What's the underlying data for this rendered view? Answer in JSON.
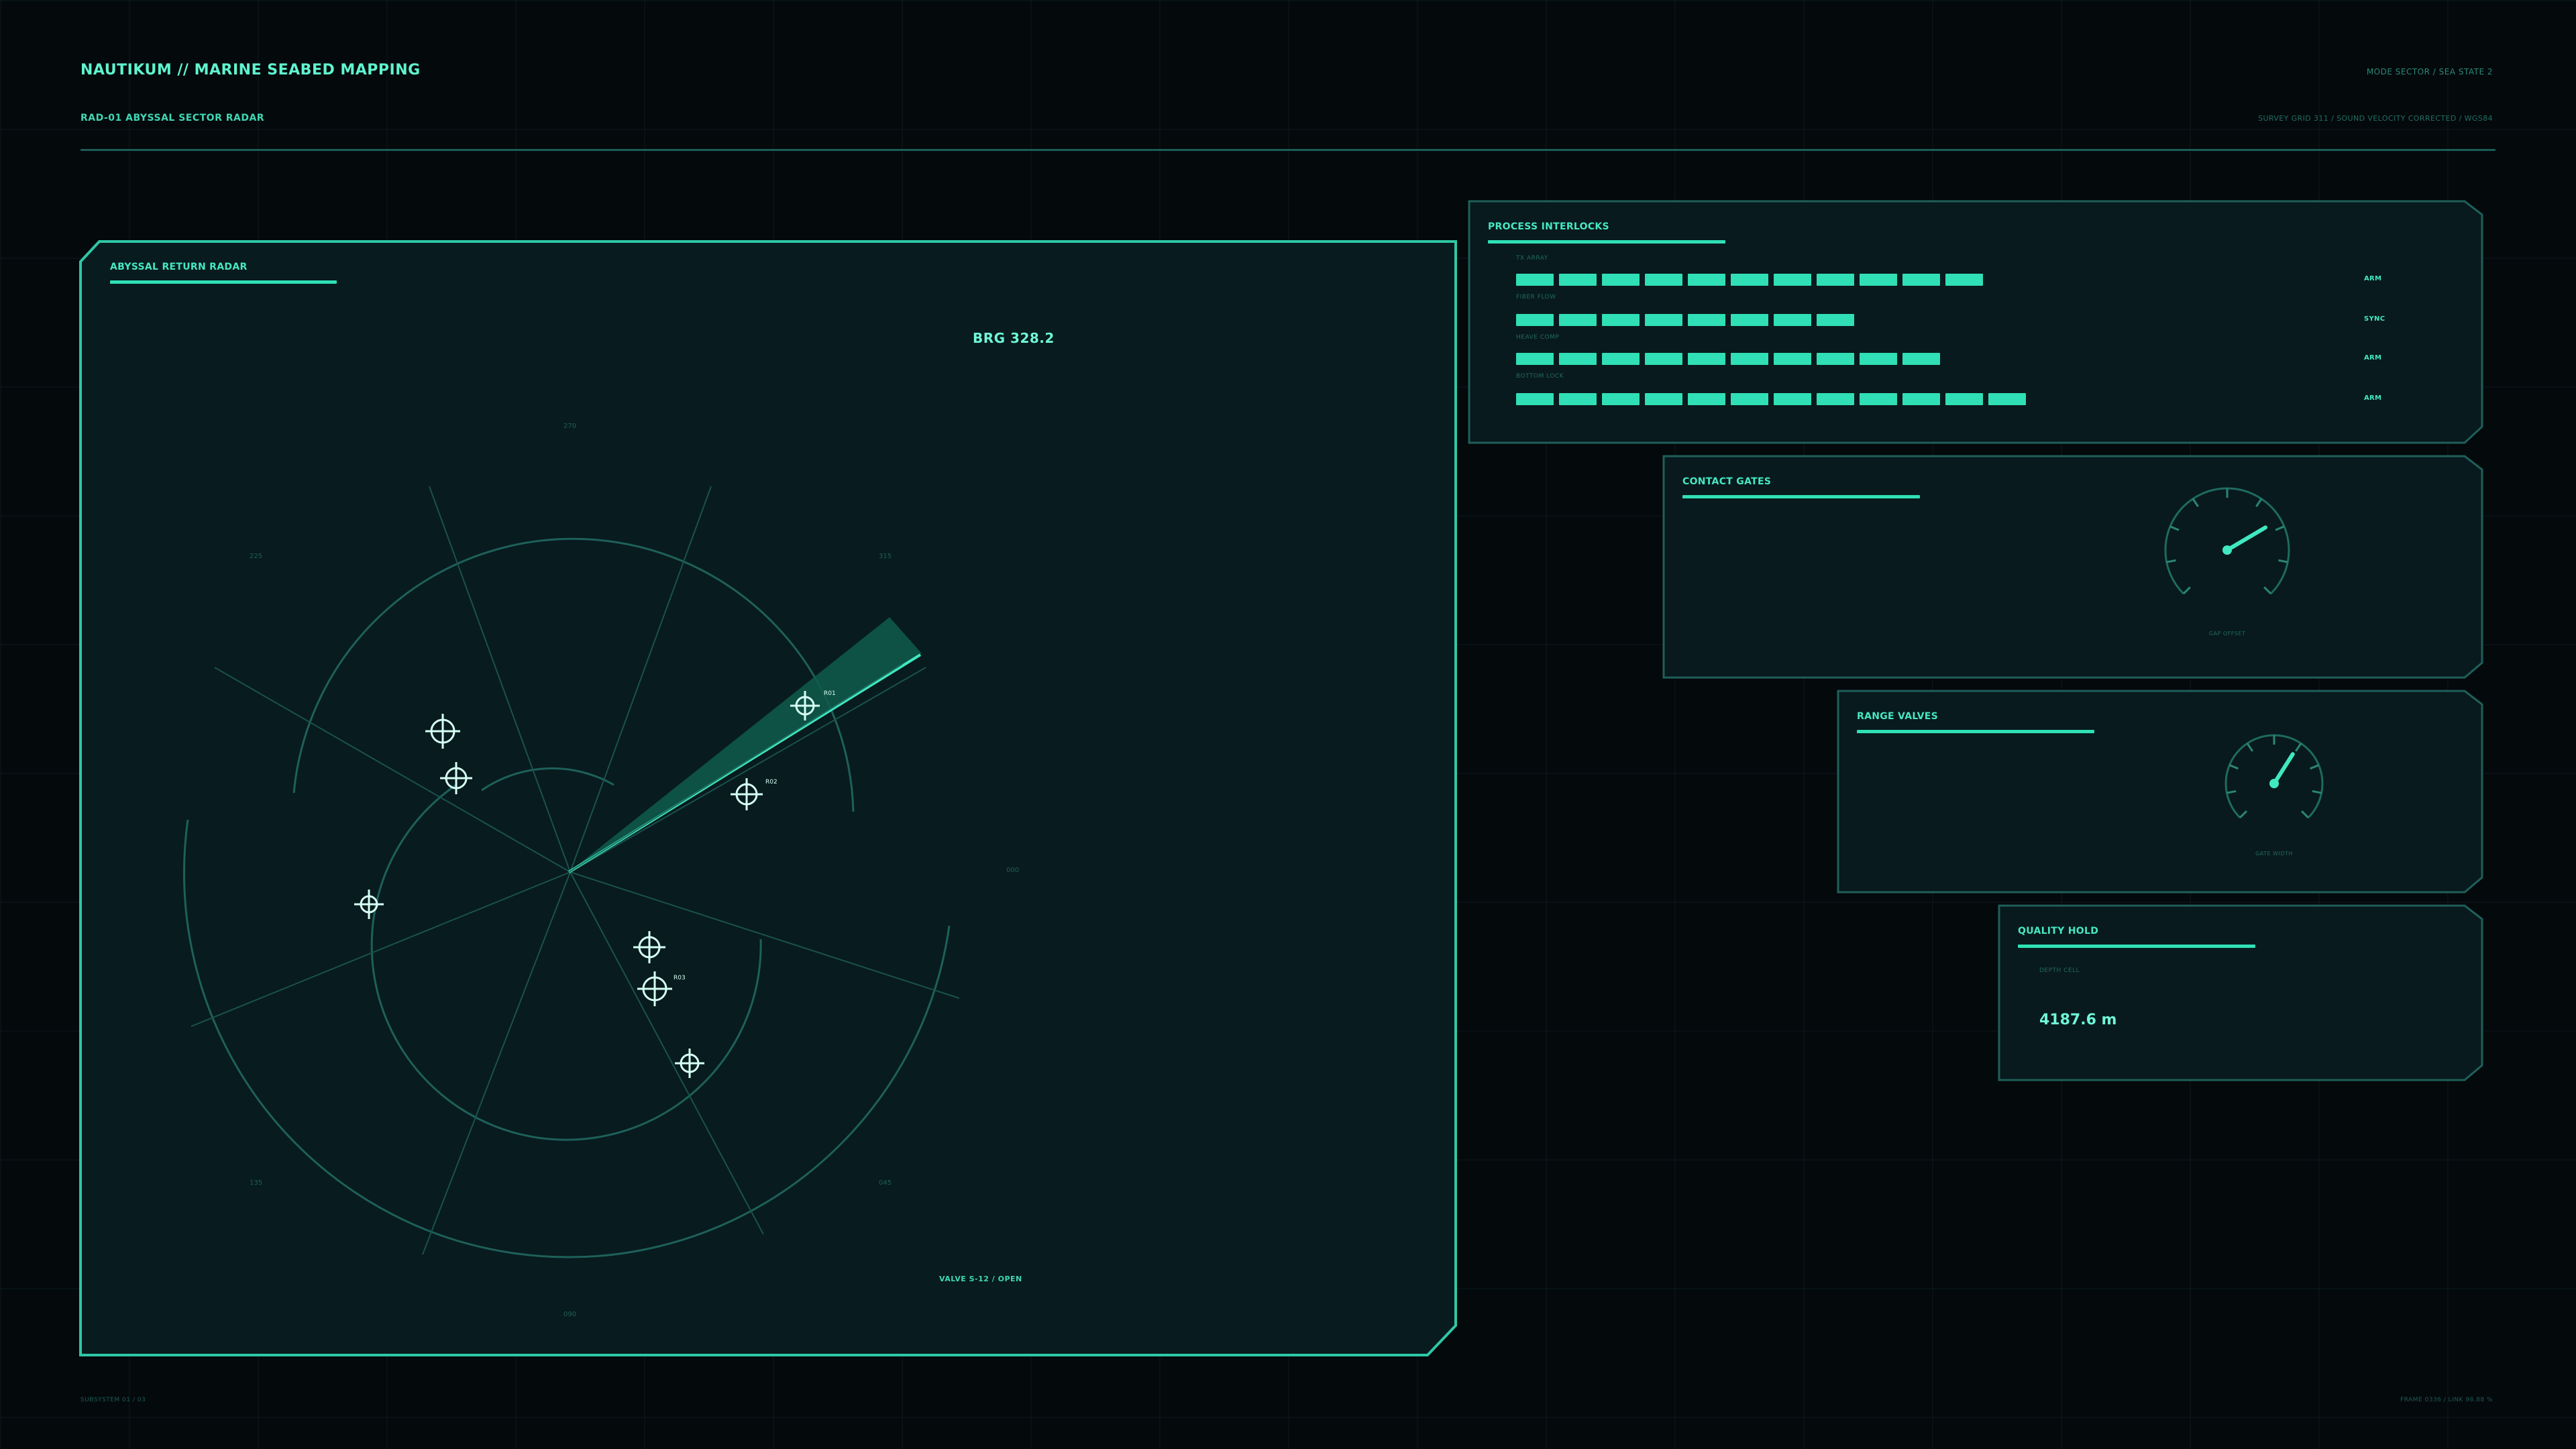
{
  "header": {
    "title": "NAUTIKUM // MARINE SEABED MAPPING",
    "subtitle": "RAD-01  ABYSSAL SECTOR RADAR",
    "mode": "MODE SECTOR / SEA STATE 2",
    "grid": "SURVEY GRID 311 / SOUND VELOCITY CORRECTED / WGS84"
  },
  "radar": {
    "title": "ABYSSAL RETURN RADAR",
    "bearing": "BRG 328.2",
    "valve": "VALVE S-12 / OPEN",
    "sweep_bearing_deg": 328.2,
    "contact_labels": [
      "R01",
      "R02",
      "R03"
    ]
  },
  "interlocks": {
    "title": "PROCESS INTERLOCKS",
    "rows": [
      {
        "label": "TX ARRAY",
        "status": "ARM",
        "level": 11
      },
      {
        "label": "FIBER FLOW",
        "status": "SYNC",
        "level": 8
      },
      {
        "label": "HEAVE COMP",
        "status": "ARM",
        "level": 10
      },
      {
        "label": "BOTTOM LOCK",
        "status": "ARM",
        "level": 12
      }
    ]
  },
  "contact_gates": {
    "title": "CONTACT GATES",
    "gauge_label": "GAP OFFSET",
    "gauge_fraction": 0.72
  },
  "range_valves": {
    "title": "RANGE VALVES",
    "gauge_label": "GATE WIDTH",
    "gauge_fraction": 0.62
  },
  "quality_hold": {
    "title": "QUALITY HOLD",
    "label": "DEPTH CELL",
    "value": "4187.6 m"
  },
  "footer": {
    "left": "SUBSYSTEM 01 / 03",
    "right": "FRAME 0336 / LINK 98.88 %"
  },
  "colors": {
    "accent": "#46f0c8",
    "background": "#04090c",
    "panel": "#081a1d",
    "line": "#1f5f59"
  }
}
